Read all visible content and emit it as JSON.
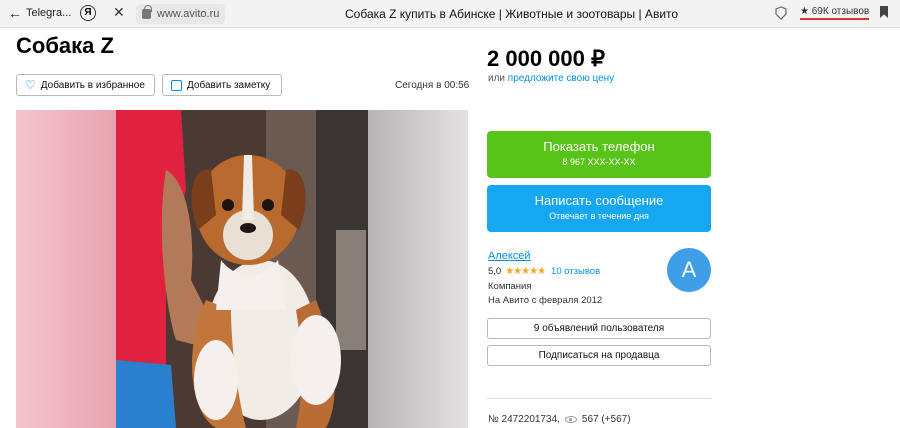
{
  "browser": {
    "back_label": "Telegra...",
    "yandex_letter": "Я",
    "close_glyph": "✕",
    "url": "www.avito.ru",
    "page_title": "Собака Z купить в Абинске | Животные и зоотовары | Авито",
    "reviews": "★ 69К отзывов"
  },
  "listing": {
    "title": "Собака Z",
    "price": "2 000 000 ₽",
    "price_or": "или",
    "price_offer_link": "предложите свою цену",
    "favorite_label": "Добавить в избранное",
    "note_label": "Добавить заметку",
    "posted": "Сегодня в 00:56"
  },
  "contact": {
    "phone_label": "Показать телефон",
    "phone_masked": "8 967 XXX-XX-XX",
    "message_label": "Написать сообщение",
    "message_sub": "Отвечает в течение дня"
  },
  "seller": {
    "name": "Алексей",
    "rating": "5,0",
    "stars": "★★★★★",
    "reviews_link": "10 отзывов",
    "type": "Компания",
    "since": "На Авито с февраля 2012",
    "avatar_letter": "А",
    "ads_button": "9 объявлений пользователя",
    "subscribe_button": "Подписаться на продавца"
  },
  "meta": {
    "ad_number": "№ 2472201734,",
    "views": "567 (+567)"
  },
  "colors": {
    "phone_button": "#58c41a",
    "message_button": "#15a7f0",
    "link": "#0091d9",
    "avatar": "#3e9ee8"
  }
}
